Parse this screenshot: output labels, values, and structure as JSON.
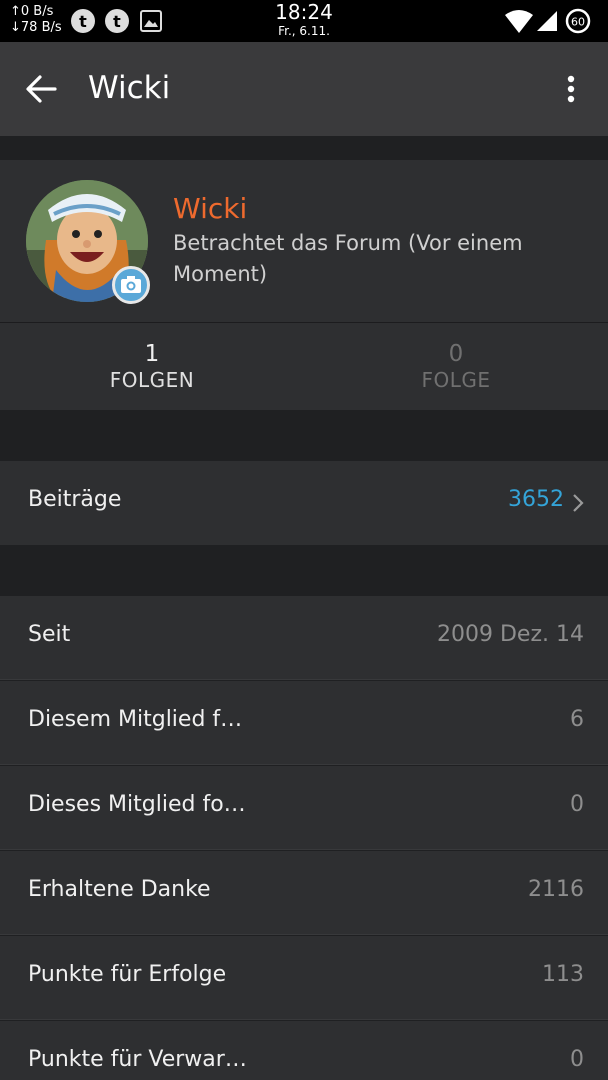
{
  "status_bar": {
    "net_up": "↑0 B/s",
    "net_down": "↓78 B/s",
    "time": "18:24",
    "date": "Fr., 6.11.",
    "battery": "60",
    "icons": [
      "tumblr-icon",
      "tumblr-icon",
      "image-icon",
      "wifi-icon",
      "signal-icon",
      "battery-icon"
    ]
  },
  "app_bar": {
    "title": "Wicki",
    "back_icon": "arrow-back-icon",
    "menu_icon": "more-vert-icon"
  },
  "profile": {
    "name": "Wicki",
    "status": "Betrachtet das Forum (Vor einem Moment)",
    "name_color": "#ee6a2e"
  },
  "follow": {
    "followers_count": "1",
    "followers_label": "FOLGEN",
    "following_count": "0",
    "following_label": "FOLGE"
  },
  "posts": {
    "label": "Beiträge",
    "value": "3652",
    "color": "#34a4d8"
  },
  "stats": [
    {
      "label": "Seit",
      "value": "2009 Dez. 14"
    },
    {
      "label": "Diesem Mitglied f…",
      "value": "6"
    },
    {
      "label": "Dieses Mitglied fo…",
      "value": "0"
    },
    {
      "label": "Erhaltene Danke",
      "value": "2116"
    },
    {
      "label": "Punkte für Erfolge",
      "value": "113"
    },
    {
      "label": "Punkte für Verwar…",
      "value": "0"
    }
  ]
}
